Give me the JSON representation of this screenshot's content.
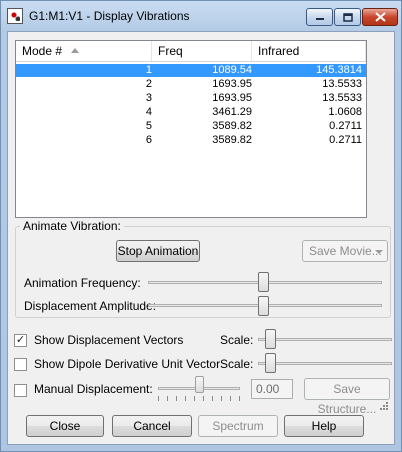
{
  "window": {
    "title": "G1:M1:V1 - Display Vibrations"
  },
  "list": {
    "headers": [
      "Mode #",
      "Freq",
      "Infrared"
    ],
    "rows": [
      {
        "mode": "1",
        "freq": "1089.54",
        "ir": "145.3814",
        "selected": true
      },
      {
        "mode": "2",
        "freq": "1693.95",
        "ir": "13.5533"
      },
      {
        "mode": "3",
        "freq": "1693.95",
        "ir": "13.5533"
      },
      {
        "mode": "4",
        "freq": "3461.29",
        "ir": "1.0608"
      },
      {
        "mode": "5",
        "freq": "3589.82",
        "ir": "0.2711"
      },
      {
        "mode": "6",
        "freq": "3589.82",
        "ir": "0.2711"
      }
    ]
  },
  "animate": {
    "group_label": "Animate Vibration:",
    "stop_label": "Stop Animation",
    "save_movie_label": "Save Movie...",
    "freq_label": "Animation Frequency:",
    "amp_label": "Displacement Amplitude:"
  },
  "options": {
    "show_vectors_label": "Show Displacement Vectors",
    "show_vectors_checked": "✓",
    "scale_label": "Scale:",
    "show_dipole_label": "Show Dipole Derivative Unit Vector",
    "manual_label": "Manual Displacement:",
    "manual_value": "0.00",
    "save_structure_label": "Save Structure..."
  },
  "buttons": {
    "close": "Close",
    "cancel": "Cancel",
    "spectrum": "Spectrum",
    "help": "Help"
  }
}
